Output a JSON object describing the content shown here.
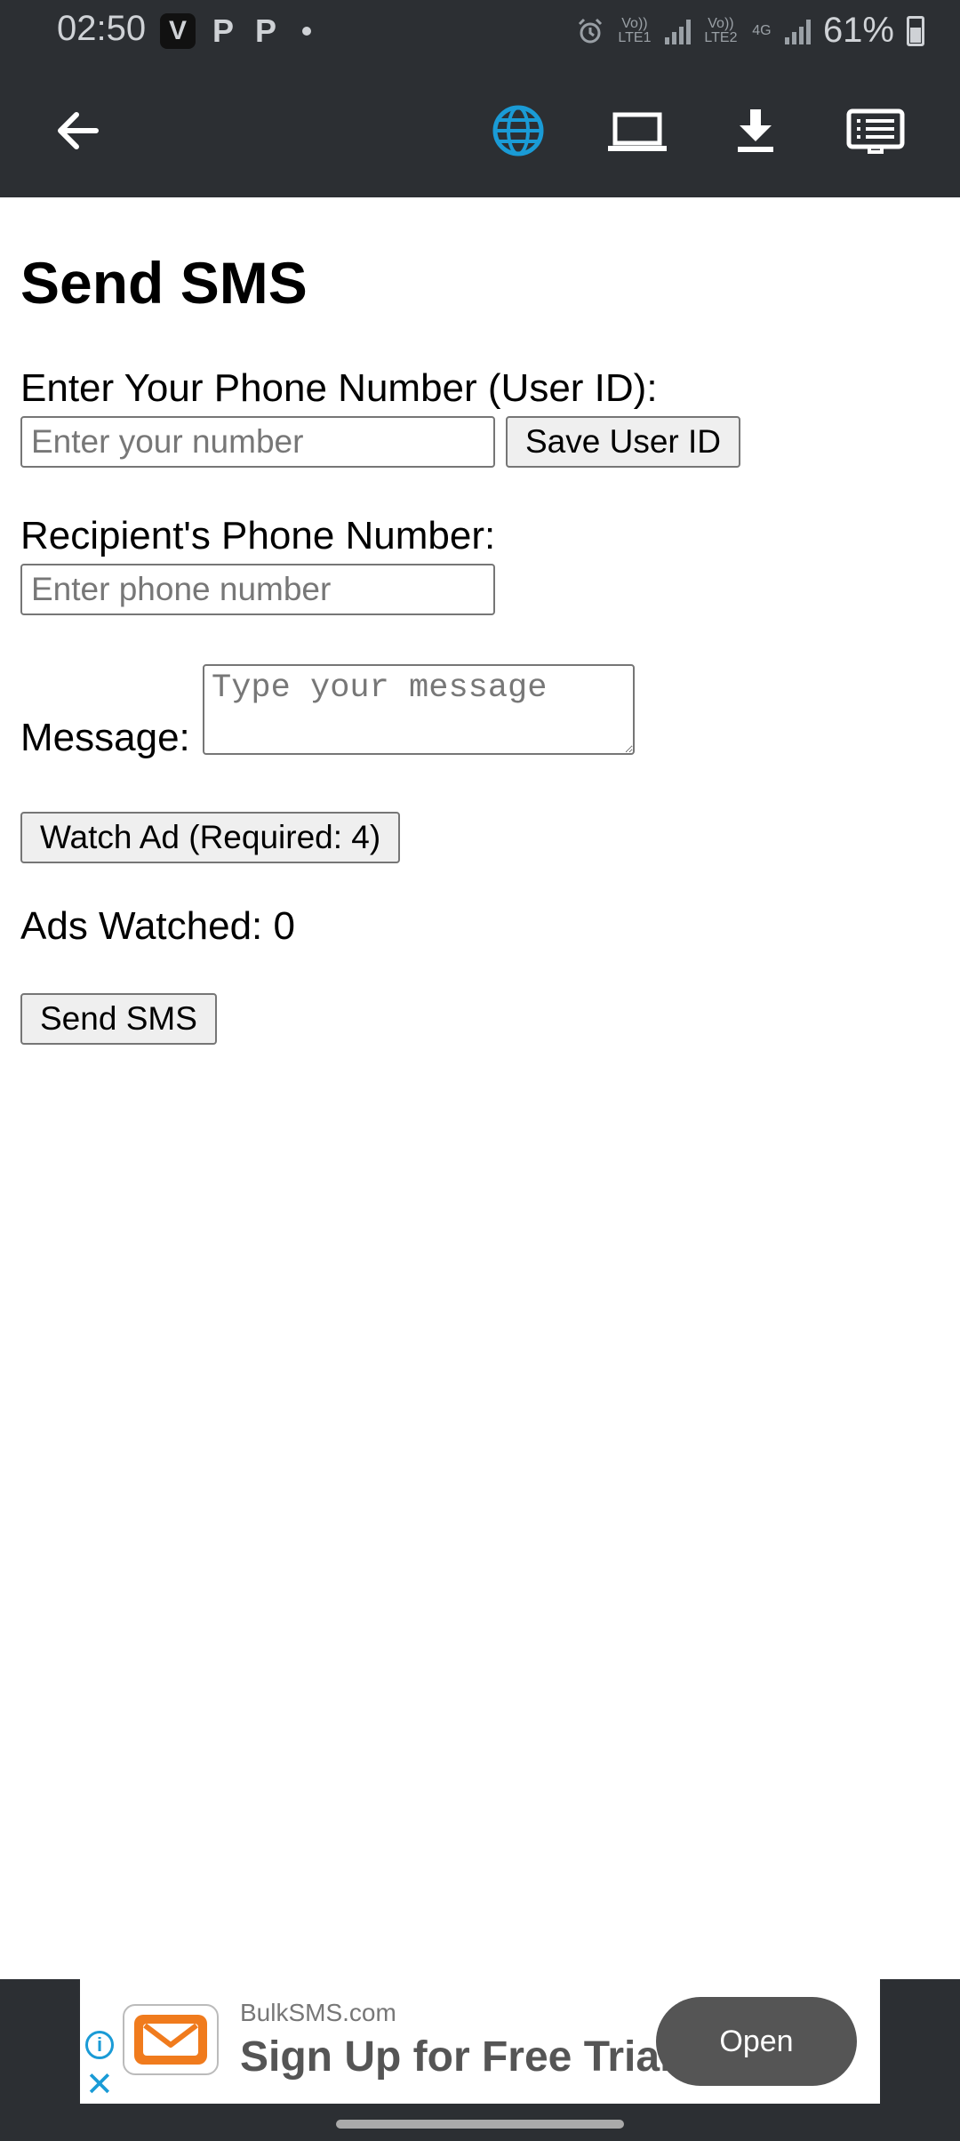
{
  "status_bar": {
    "time": "02:50",
    "app_icons": [
      "V",
      "P",
      "P"
    ],
    "network_labels": [
      "Vo)) LTE1",
      "Vo)) LTE2",
      "4G"
    ],
    "battery_percent": "61%"
  },
  "app_bar": {
    "back_icon": "back-arrow-icon",
    "actions": [
      "globe-icon",
      "laptop-icon",
      "download-icon",
      "list-icon"
    ],
    "accent_color": "#1a9bd6"
  },
  "page": {
    "title": "Send SMS",
    "user_id_label": "Enter Your Phone Number (User ID):",
    "user_id_placeholder": "Enter your number",
    "user_id_value": "",
    "save_user_id_label": "Save User ID",
    "recipient_label": "Recipient's Phone Number:",
    "recipient_placeholder": "Enter phone number",
    "recipient_value": "",
    "message_label": "Message:",
    "message_placeholder": "Type your message",
    "watch_ad_label": "Watch Ad (Required: 4)",
    "ads_watched_text": "Ads Watched: 0",
    "send_label": "Send SMS"
  },
  "ad": {
    "domain": "BulkSMS.com",
    "headline": "Sign Up for Free Trial",
    "cta": "Open",
    "logo_color": "#f07b1d"
  }
}
